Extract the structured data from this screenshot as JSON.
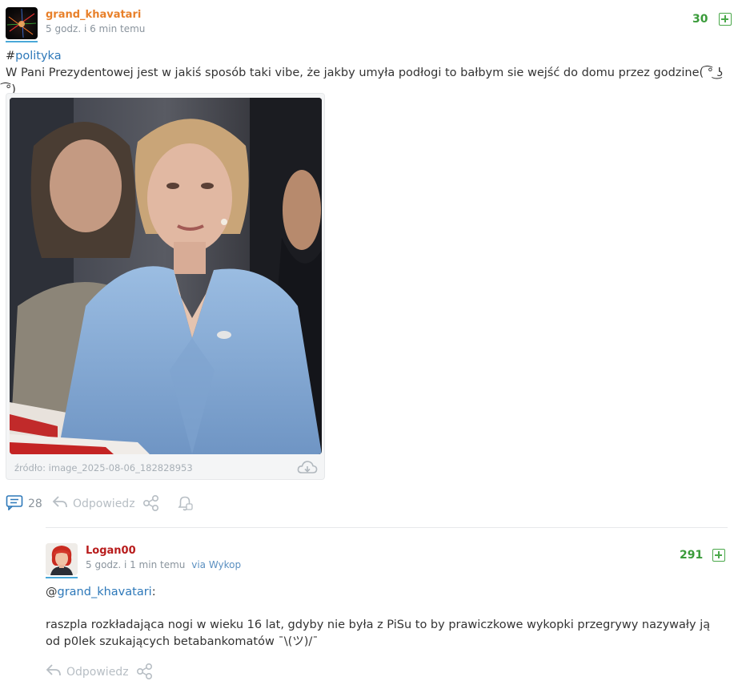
{
  "post": {
    "author": "grand_khavatari",
    "time": "5 godz. i 6 min temu",
    "score": "30",
    "hash": "#",
    "tag": "polityka",
    "text": "W Pani Prezydentowej jest w jakiś sposób taki vibe, że jakby umyła podłogi to bałbym sie wejść do domu przez godzine( ͡° ͜ʖ ͡°)",
    "source": "źródło: image_2025-08-06_182828953",
    "comments_count": "28",
    "reply_label": "Odpowiedz"
  },
  "reply": {
    "author": "Logan00",
    "time": "5 godz. i 1 min temu",
    "via": "via Wykop",
    "score": "291",
    "mention_at": "@",
    "mention_user": "grand_khavatari",
    "mention_colon": ":",
    "text": "raszpla rozkładająca nogi w wieku 16 lat, gdyby nie była z PiSu to by prawiczkowe wykopki przegrywy nazywały ją od p0lek szukających betabankomatów ¯\\(ツ)/¯",
    "reply_label": "Odpowiedz"
  },
  "colors": {
    "author_main": "#e8802a",
    "author_reply": "#b81c1c",
    "score": "#3a9b3a",
    "link": "#2d78b9"
  },
  "icons": [
    "plus-icon",
    "comments-icon",
    "reply-icon",
    "share-icon",
    "notification-bell-icon",
    "download-cloud-icon"
  ]
}
